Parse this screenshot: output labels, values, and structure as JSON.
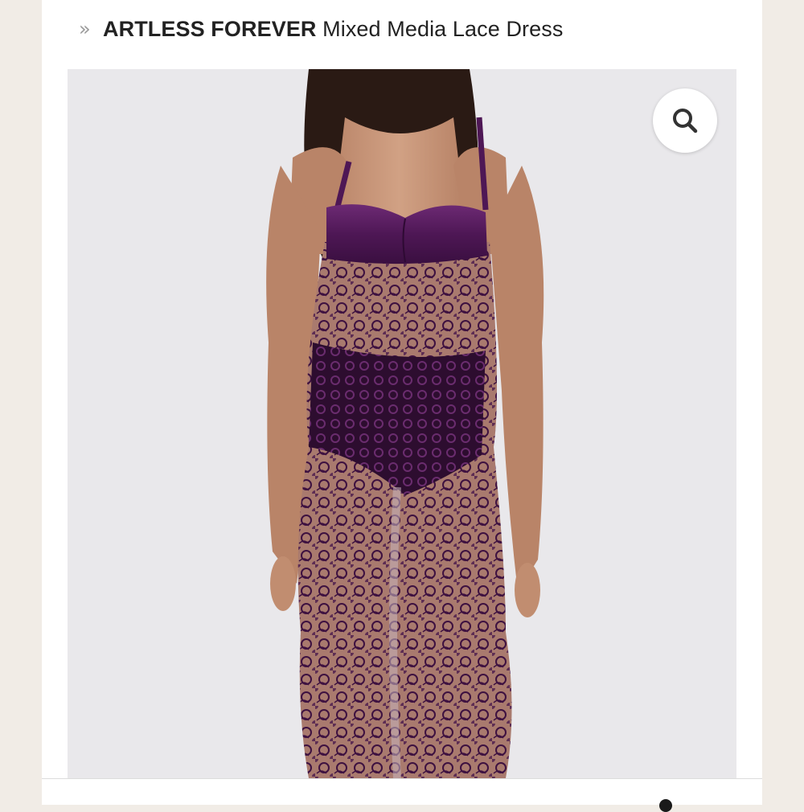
{
  "breadcrumb": {
    "chevron": "»",
    "brand": "ARTLESS FOREVER",
    "product_name": "Mixed Media Lace Dress"
  },
  "gallery": {
    "zoom_icon": "search-icon"
  },
  "colors": {
    "dress_purple": "#4a1a4c",
    "satin_purple": "#5b1f62",
    "photo_background": "#e9e8eb"
  }
}
